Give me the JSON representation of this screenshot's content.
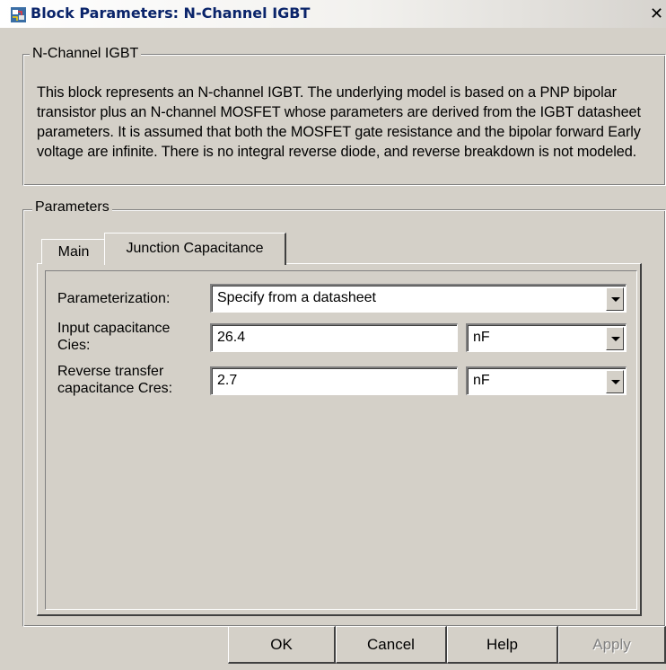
{
  "window": {
    "title": "Block Parameters: N-Channel IGBT",
    "close_label": "✕"
  },
  "description_group": {
    "legend": "N-Channel IGBT",
    "text": "This block represents an N-channel IGBT. The underlying model is based on a PNP bipolar transistor plus an N-channel MOSFET whose parameters are derived from the IGBT datasheet parameters. It is assumed that both the MOSFET gate resistance and the bipolar forward Early voltage are infinite. There is no integral reverse diode, and reverse breakdown is not modeled."
  },
  "parameters_group": {
    "legend": "Parameters",
    "tabs": [
      {
        "label": "Main",
        "active": false
      },
      {
        "label": "Junction Capacitance",
        "active": true
      }
    ],
    "fields": {
      "parameterization": {
        "label": "Parameterization:",
        "value": "Specify from a datasheet"
      },
      "cies": {
        "label_line1": "Input capacitance",
        "label_line2": "Cies:",
        "value": "26.4",
        "unit": "nF"
      },
      "cres": {
        "label_line1": "Reverse transfer",
        "label_line2": "capacitance Cres:",
        "value": "2.7",
        "unit": "nF"
      }
    }
  },
  "buttons": {
    "ok": "OK",
    "cancel": "Cancel",
    "help": "Help",
    "apply": "Apply"
  },
  "colors": {
    "title_text": "#0a246a",
    "dialog_face": "#d4d0c8",
    "disabled_text": "#808080"
  },
  "icons": {
    "title": "simulink-block-icon",
    "close": "close-icon",
    "dropdown": "chevron-down-icon"
  }
}
